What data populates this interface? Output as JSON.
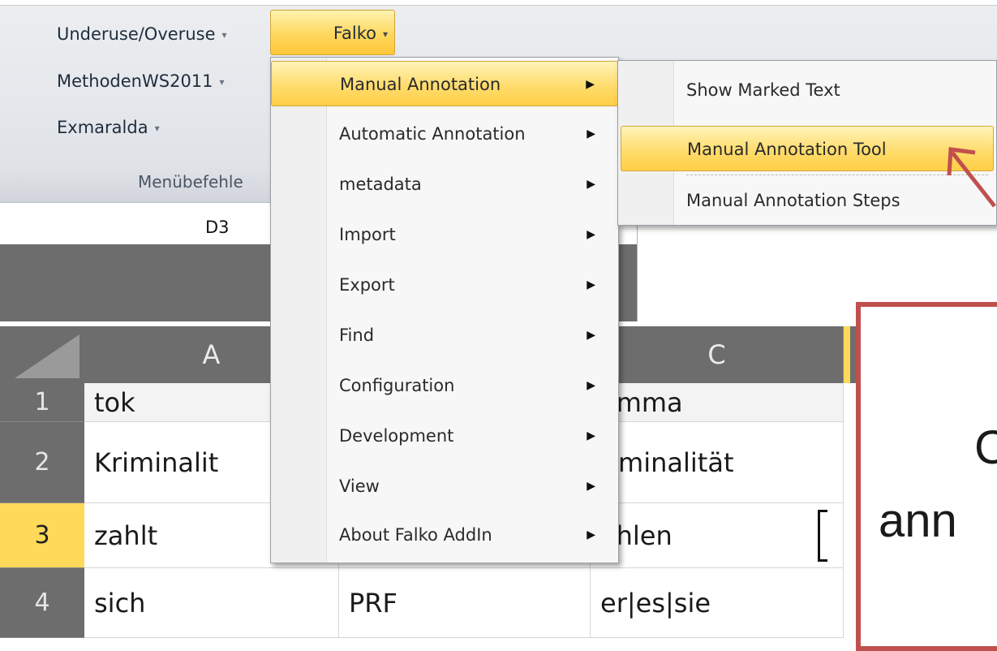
{
  "ribbon": {
    "buttons": {
      "underuse": "Underuse/Overuse",
      "falko": "Falko",
      "methoden": "MethodenWS2011",
      "exmaralda": "Exmaralda"
    },
    "caret": "▾",
    "group_label": "Menübefehle"
  },
  "name_box": {
    "value": "D3"
  },
  "falko_menu": {
    "items": [
      {
        "label": "Manual Annotation",
        "highlighted": true
      },
      {
        "label": "Automatic Annotation"
      },
      {
        "label": "metadata"
      },
      {
        "label": "Import"
      },
      {
        "label": "Export"
      },
      {
        "label": "Find"
      },
      {
        "label": "Configuration"
      },
      {
        "label": "Development"
      },
      {
        "label": "View"
      },
      {
        "label": "About Falko AddIn"
      }
    ],
    "submenu_arrow": "▶"
  },
  "manual_annotation_submenu": {
    "items": [
      {
        "label": "Show Marked Text"
      },
      {
        "label": "Manual Annotation Tool",
        "highlighted": true
      },
      {
        "label": "Manual Annotation Steps"
      }
    ]
  },
  "sheet": {
    "columns": [
      "A",
      "C"
    ],
    "rows": [
      "1",
      "2",
      "3",
      "4"
    ],
    "selected_row": "3",
    "cells": {
      "A1": "tok",
      "A2": "Kriminalit",
      "A3": "zahlt",
      "A4": "sich",
      "B4": "PRF",
      "C1": "emma",
      "C2": "riminalität",
      "C3": "ahlen",
      "C4": "er|es|sie"
    }
  },
  "callout": {
    "line1": "C",
    "line2": "ann"
  },
  "colors": {
    "highlight": "#ffd75e",
    "callout_border": "#c0504d",
    "header_grey": "#6d6d6d"
  }
}
